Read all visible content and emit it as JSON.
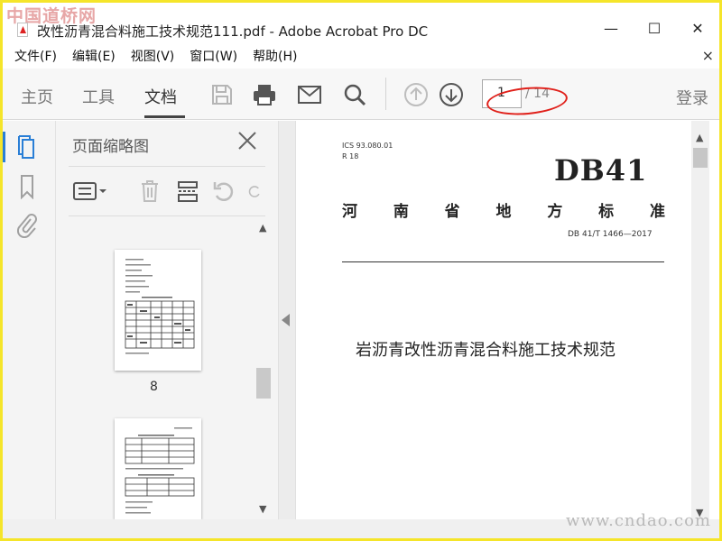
{
  "watermark_top": "中国道桥网",
  "watermark_bottom": "www.cndao.com",
  "window": {
    "title": "改性沥青混合料施工技术规范111.pdf - Adobe Acrobat Pro DC",
    "minimize": "—",
    "maximize": "☐",
    "close": "✕"
  },
  "menu": {
    "items": [
      "文件(F)",
      "编辑(E)",
      "视图(V)",
      "窗口(W)",
      "帮助(H)"
    ],
    "close": "×"
  },
  "toolbar": {
    "tabs": [
      "主页",
      "工具",
      "文档"
    ],
    "active_tab": "文档",
    "current_page": "1",
    "total_pages": "/ 14",
    "login": "登录"
  },
  "thumbnails": {
    "title": "页面缩略图",
    "page_label": "8"
  },
  "document": {
    "ics": "ICS  93.080.01",
    "r": "R 18",
    "db": "DB41",
    "standard_chars": [
      "河",
      "南",
      "省",
      "地",
      "方",
      "标",
      "准"
    ],
    "std_number": "DB 41/T 1466—2017",
    "title": "岩沥青改性沥青混合料施工技术规范"
  },
  "colors": {
    "accent_blue": "#2a7fd6",
    "annotation_red": "#e0201a",
    "frame_yellow": "#f5e52a"
  }
}
